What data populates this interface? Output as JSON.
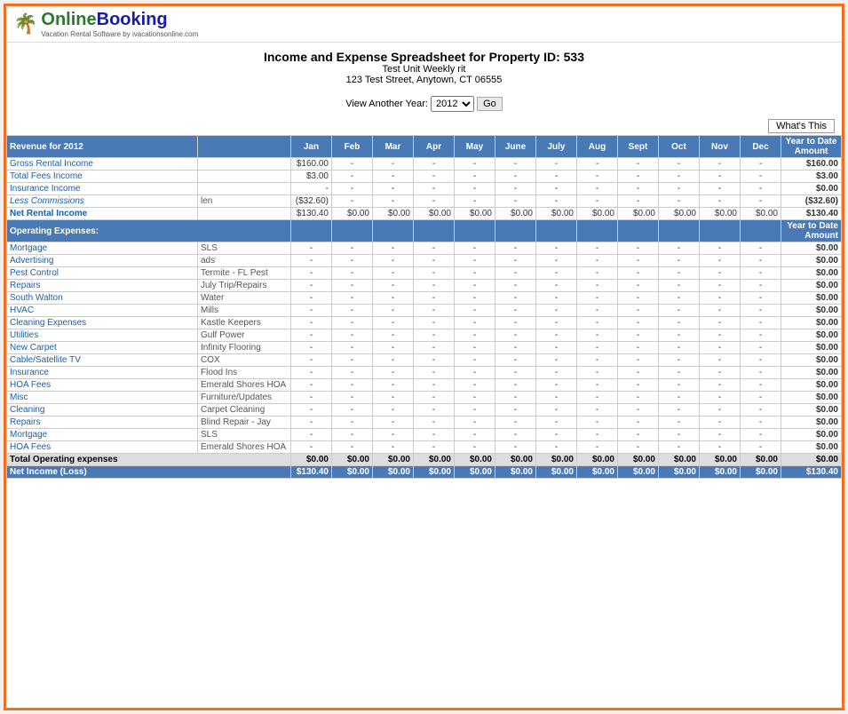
{
  "logo": {
    "online": "Online",
    "booking": "Booking",
    "sub": "Vacation Rental Software by ivacationsonline.com"
  },
  "header": {
    "title": "Income and Expense Spreadsheet for Property ID: 533",
    "unit": "Test Unit Weekly rit",
    "address": "123 Test Street, Anytown, CT 06555"
  },
  "year_selector": {
    "label": "View Another Year:",
    "year": "2012",
    "go_btn": "Go"
  },
  "whats_this": "What's This",
  "revenue_header": "Revenue for 2012",
  "months": [
    "Jan",
    "Feb",
    "Mar",
    "Apr",
    "May",
    "June",
    "July",
    "Aug",
    "Sept",
    "Oct",
    "Nov",
    "Dec"
  ],
  "ytd_label": "Year to Date Amount",
  "revenue_rows": [
    {
      "label": "Gross Rental Income",
      "vendor": "",
      "jan": "$160.00",
      "values": [
        "-",
        "-",
        "-",
        "-",
        "-",
        "-",
        "-",
        "-",
        "-",
        "-",
        "-"
      ],
      "ytd": "$160.00"
    },
    {
      "label": "Total Fees Income",
      "vendor": "",
      "jan": "$3.00",
      "values": [
        "-",
        "-",
        "-",
        "-",
        "-",
        "-",
        "-",
        "-",
        "-",
        "-",
        "-"
      ],
      "ytd": "$3.00"
    },
    {
      "label": "Insurance Income",
      "vendor": "",
      "jan": "-",
      "values": [
        "-",
        "-",
        "-",
        "-",
        "-",
        "-",
        "-",
        "-",
        "-",
        "-",
        "-"
      ],
      "ytd": "$0.00"
    },
    {
      "label": "Less Commissions",
      "vendor": "len",
      "jan": "($32.60)",
      "values": [
        "-",
        "-",
        "-",
        "-",
        "-",
        "-",
        "-",
        "-",
        "-",
        "-",
        "-"
      ],
      "ytd": "($32.60)",
      "italic": true,
      "neg": true
    },
    {
      "label": "Net Rental Income",
      "vendor": "",
      "jan": "$130.40",
      "values": [
        "$0.00",
        "$0.00",
        "$0.00",
        "$0.00",
        "$0.00",
        "$0.00",
        "$0.00",
        "$0.00",
        "$0.00",
        "$0.00",
        "$0.00"
      ],
      "ytd": "$130.40",
      "bold": true
    }
  ],
  "operating_header": "Operating Expenses:",
  "expense_rows": [
    {
      "label": "Mortgage",
      "vendor": "SLS"
    },
    {
      "label": "Advertising",
      "vendor": "ads"
    },
    {
      "label": "Pest Control",
      "vendor": "Termite - FL Pest"
    },
    {
      "label": "Repairs",
      "vendor": "July Trip/Repairs"
    },
    {
      "label": "South Walton",
      "vendor": "Water"
    },
    {
      "label": "HVAC",
      "vendor": "Mills"
    },
    {
      "label": "Cleaning Expenses",
      "vendor": "Kastle Keepers"
    },
    {
      "label": "Utilities",
      "vendor": "Gulf Power"
    },
    {
      "label": "New Carpet",
      "vendor": "Infinity Flooring"
    },
    {
      "label": "Cable/Satellite TV",
      "vendor": "COX"
    },
    {
      "label": "Insurance",
      "vendor": "Flood Ins"
    },
    {
      "label": "HOA Fees",
      "vendor": "Emerald Shores HOA"
    },
    {
      "label": "Misc",
      "vendor": "Furniture/Updates"
    },
    {
      "label": "Cleaning",
      "vendor": "Carpet Cleaning"
    },
    {
      "label": "Repairs",
      "vendor": "Blind Repair - Jay"
    },
    {
      "label": "Mortgage",
      "vendor": "SLS"
    },
    {
      "label": "HOA Fees",
      "vendor": "Emerald Shores HOA"
    }
  ],
  "total_operating": {
    "label": "Total Operating expenses",
    "values": [
      "$0.00",
      "$0.00",
      "$0.00",
      "$0.00",
      "$0.00",
      "$0.00",
      "$0.00",
      "$0.00",
      "$0.00",
      "$0.00",
      "$0.00",
      "$0.00"
    ],
    "ytd": "$0.00"
  },
  "net_income": {
    "label": "Net Income (Loss)",
    "values": [
      "$0.00",
      "$0.00",
      "$0.00",
      "$0.00",
      "$0.00",
      "$0.00",
      "$0.00",
      "$0.00",
      "$0.00",
      "$0.00",
      "$0.00"
    ],
    "jan": "$130.40",
    "ytd": "$130.40"
  }
}
